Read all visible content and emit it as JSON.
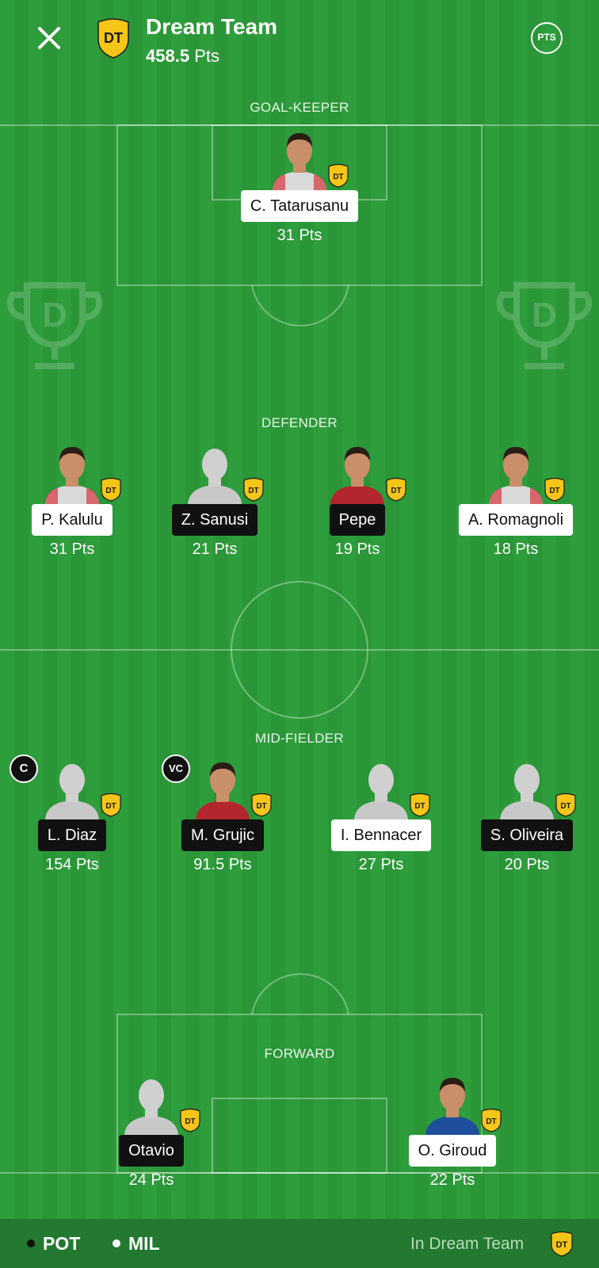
{
  "header": {
    "badge": "DT",
    "title": "Dream Team",
    "points_value": "458.5",
    "points_unit": "Pts",
    "pts_button": "PTS"
  },
  "sections": {
    "goalkeeper": "GOAL-KEEPER",
    "defender": "DEFENDER",
    "midfielder": "MID-FIELDER",
    "forward": "FORWARD"
  },
  "badge_text": "DT",
  "players": [
    {
      "name": "C. Tatarusanu",
      "pts": "31 Pts",
      "team": "MIL",
      "has_photo": true
    },
    {
      "name": "P. Kalulu",
      "pts": "31 Pts",
      "team": "MIL",
      "has_photo": true
    },
    {
      "name": "Z. Sanusi",
      "pts": "21 Pts",
      "team": "POT",
      "has_photo": false
    },
    {
      "name": "Pepe",
      "pts": "19 Pts",
      "team": "POT",
      "has_photo": true
    },
    {
      "name": "A. Romagnoli",
      "pts": "18 Pts",
      "team": "MIL",
      "has_photo": true
    },
    {
      "name": "L. Diaz",
      "pts": "154 Pts",
      "team": "POT",
      "has_photo": false,
      "role": "C"
    },
    {
      "name": "M. Grujic",
      "pts": "91.5 Pts",
      "team": "POT",
      "has_photo": true,
      "role": "VC"
    },
    {
      "name": "I. Bennacer",
      "pts": "27 Pts",
      "team": "MIL",
      "has_photo": false
    },
    {
      "name": "S. Oliveira",
      "pts": "20 Pts",
      "team": "POT",
      "has_photo": false
    },
    {
      "name": "Otavio",
      "pts": "24 Pts",
      "team": "POT",
      "has_photo": false
    },
    {
      "name": "O. Giroud",
      "pts": "22 Pts",
      "team": "MIL",
      "has_photo": true
    }
  ],
  "footer": {
    "team1": "POT",
    "team1_color": "#111111",
    "team2": "MIL",
    "team2_color": "#ffffff",
    "legend": "In Dream Team",
    "legend_badge": "DT"
  },
  "colors": {
    "pitch": "#2e9d3c",
    "badge_yellow": "#f5c518",
    "footer": "#23792f"
  }
}
